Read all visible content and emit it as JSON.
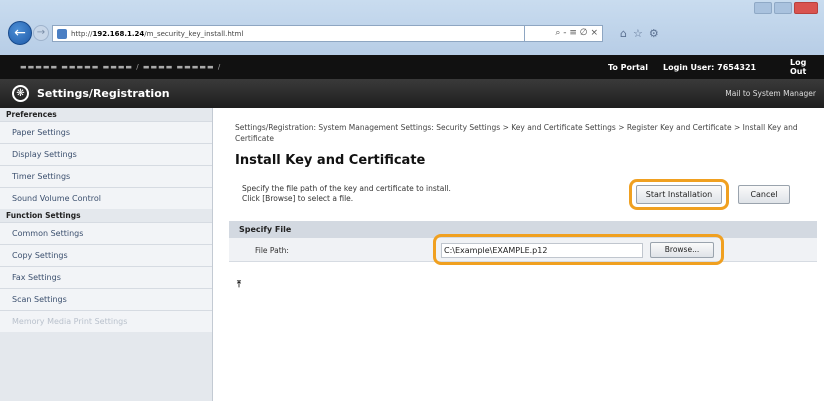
{
  "browser": {
    "url_prefix": "http://",
    "url_host": "192.168.1.24",
    "url_path": "/m_security_key_install.html",
    "search_hint": "⌕ - ≡ ∅ ×",
    "tool_icons": [
      "home-icon",
      "star-icon",
      "gear-icon"
    ]
  },
  "portal_bar": {
    "to_portal": "To Portal",
    "login_user": "Login User:  7654321",
    "log_out": "Log Out"
  },
  "title_bar": {
    "title": "Settings/Registration",
    "mail_link": "Mail to System Manager"
  },
  "sidebar": {
    "sections": [
      {
        "heading": "Preferences",
        "items": [
          "Paper Settings",
          "Display Settings",
          "Timer Settings",
          "Sound Volume Control"
        ]
      },
      {
        "heading": "Function Settings",
        "items": [
          "Common Settings",
          "Copy Settings",
          "Fax Settings",
          "Scan Settings",
          "Memory Media Print Settings"
        ]
      }
    ]
  },
  "main": {
    "breadcrumb": "Settings/Registration: System Management Settings: Security Settings > Key and Certificate Settings > Register Key and Certificate > Install Key and Certificate",
    "heading": "Install Key and Certificate",
    "desc_line1": "Specify the file path of the key and certificate to install.",
    "desc_line2": "Click [Browse] to select a file.",
    "start_button": "Start Installation",
    "cancel_button": "Cancel",
    "section_title": "Specify File",
    "file_path_label": "File Path:",
    "file_path_value": "C:\\Example\\EXAMPLE.p12",
    "browse_button": "Browse...",
    "top_arrow": "⤒"
  },
  "colors": {
    "highlight": "#f0a020",
    "portal_bar": "#111111",
    "title_bar": "#2a2a2a",
    "sidebar_bg": "#e4e8ed"
  }
}
